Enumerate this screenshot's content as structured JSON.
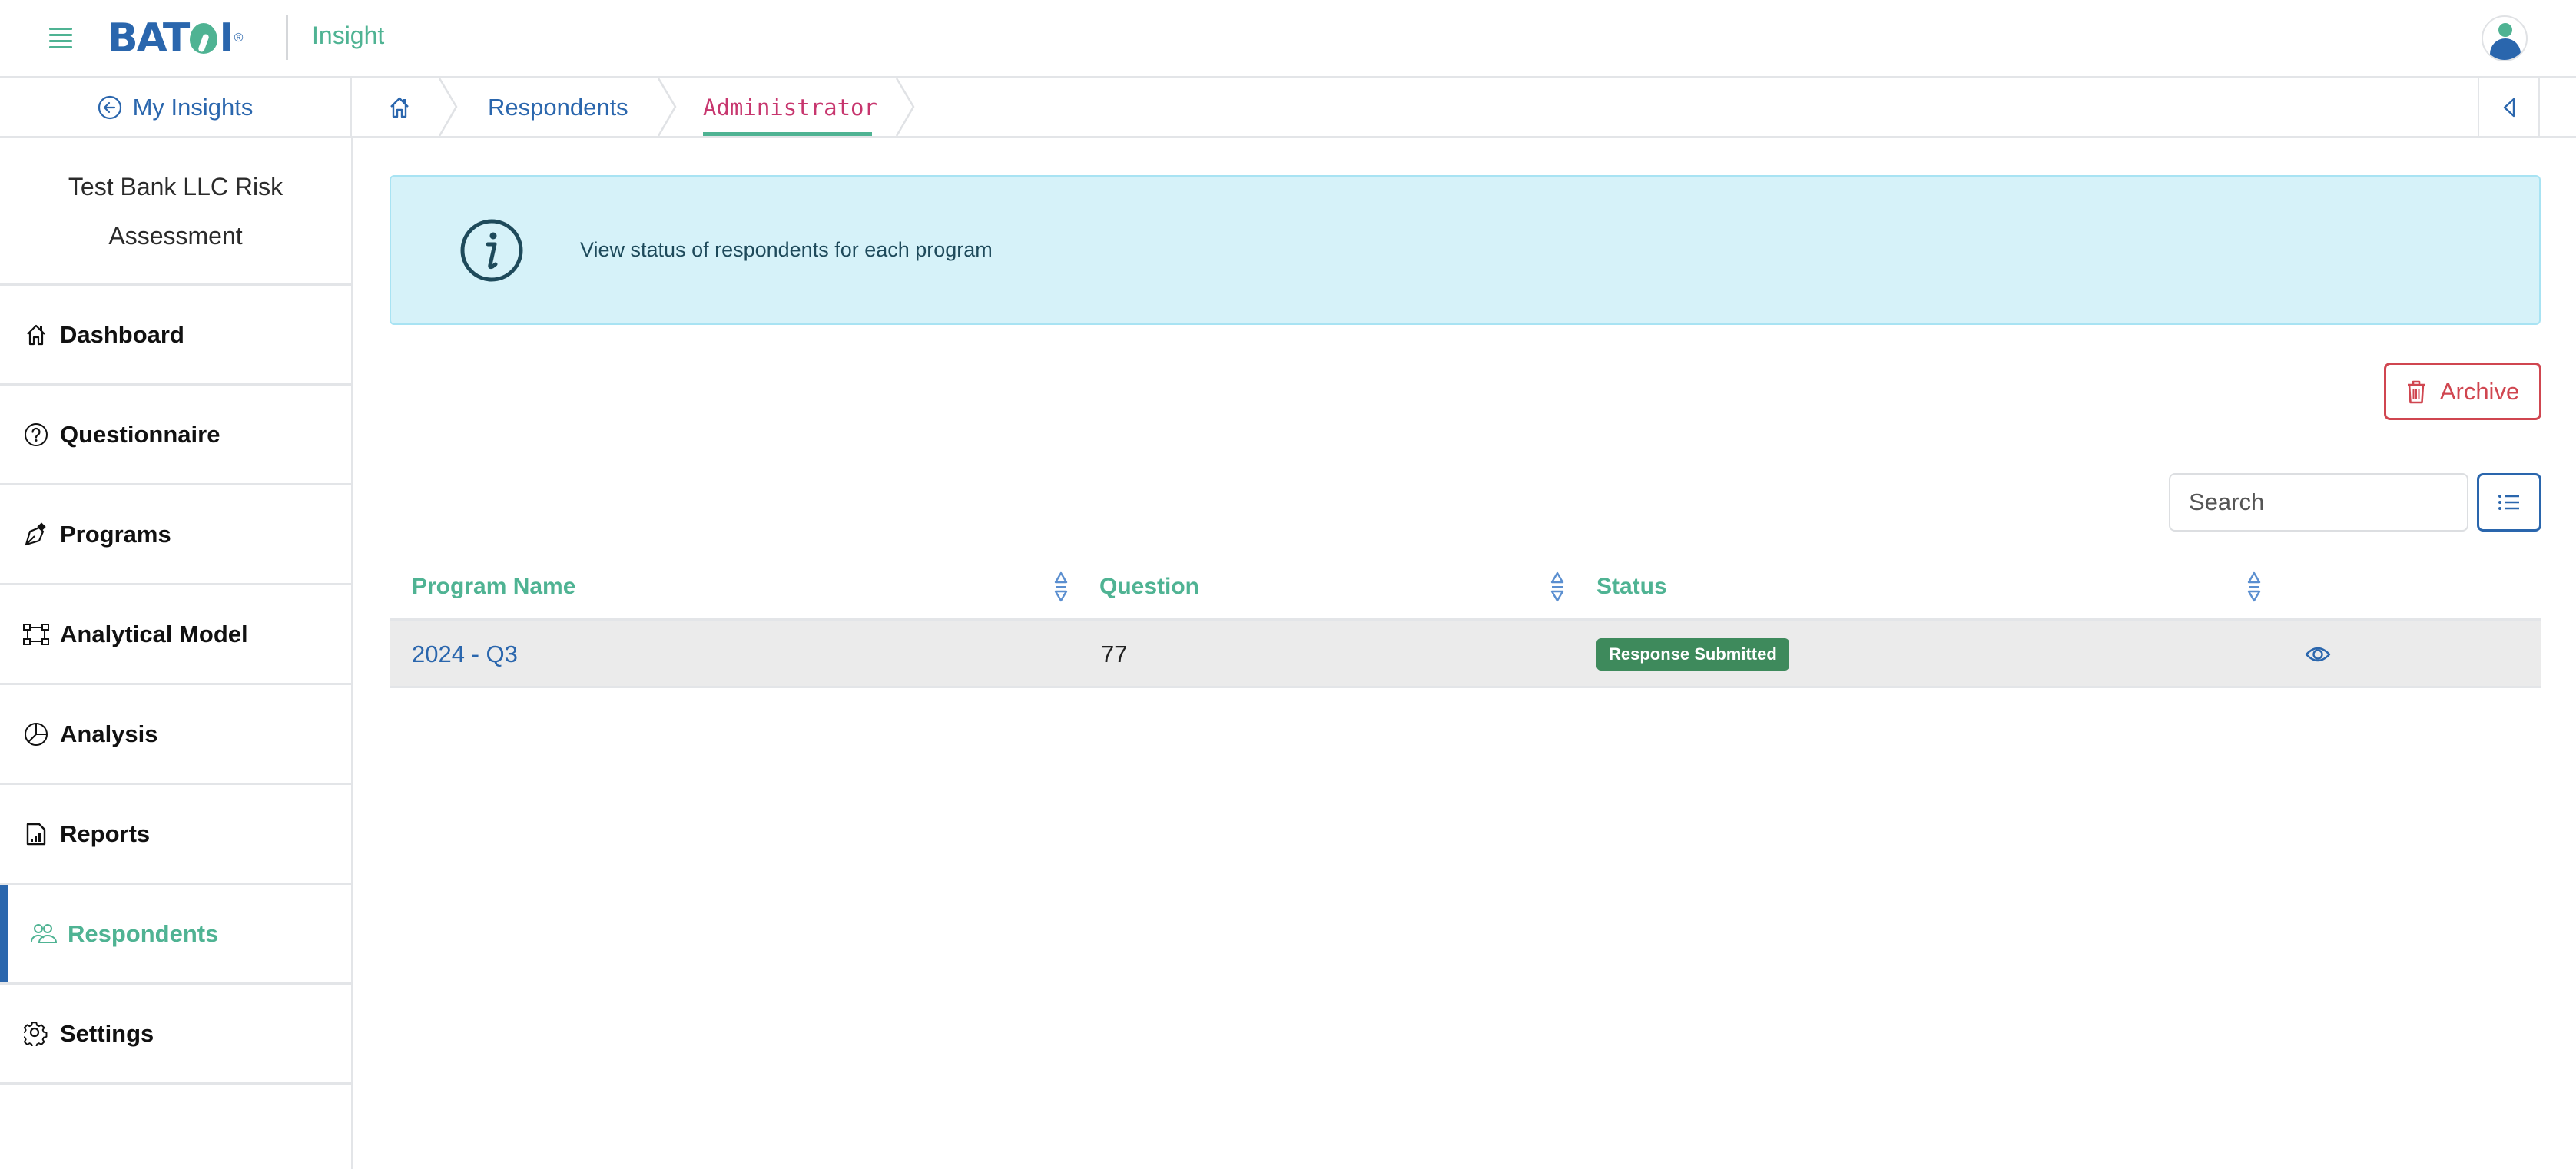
{
  "header": {
    "logo_text_left": "BAT",
    "logo_text_right": "I",
    "logo_reg": "®",
    "app_name": "Insight",
    "menu_icon": "hamburger-icon",
    "avatar_icon": "user-avatar-icon"
  },
  "breadcrumb": {
    "back_label": "My Insights",
    "back_icon": "circle-arrow-left-icon",
    "home_icon": "home-icon",
    "items": [
      {
        "label": "Respondents"
      },
      {
        "label": "Administrator",
        "active": true
      }
    ],
    "collapse_icon": "triangle-left-icon"
  },
  "sidebar": {
    "project_title": "Test Bank LLC Risk Assessment",
    "items": [
      {
        "label": "Dashboard",
        "icon": "home-icon"
      },
      {
        "label": "Questionnaire",
        "icon": "question-circle-icon"
      },
      {
        "label": "Programs",
        "icon": "pen-nib-icon"
      },
      {
        "label": "Analytical Model",
        "icon": "bounding-box-icon"
      },
      {
        "label": "Analysis",
        "icon": "pie-chart-icon"
      },
      {
        "label": "Reports",
        "icon": "file-bar-chart-icon"
      },
      {
        "label": "Respondents",
        "icon": "people-icon",
        "active": true
      },
      {
        "label": "Settings",
        "icon": "gear-icon"
      }
    ]
  },
  "info_banner": {
    "icon": "info-circle-icon",
    "text": "View status of respondents for each program"
  },
  "toolbar": {
    "archive_label": "Archive",
    "archive_icon": "trash-icon",
    "search_placeholder": "Search",
    "search_value": "",
    "column_toggle_icon": "list-icon"
  },
  "table": {
    "columns": [
      {
        "label": "Program Name",
        "sortable": true
      },
      {
        "label": "Question",
        "sortable": true
      },
      {
        "label": "Status",
        "sortable": true
      },
      {
        "label": "",
        "sortable": true
      }
    ],
    "rows": [
      {
        "program_name": "2024 - Q3",
        "question": "77",
        "status": "Response Submitted",
        "action_icon": "eye-icon"
      }
    ]
  },
  "colors": {
    "brand_blue": "#2a66ad",
    "brand_green": "#4fb393",
    "status_submitted": "#3e8a5c",
    "danger": "#d04650",
    "info_bg": "#d6f2f9",
    "breadcrumb_active": "#c7366e"
  }
}
